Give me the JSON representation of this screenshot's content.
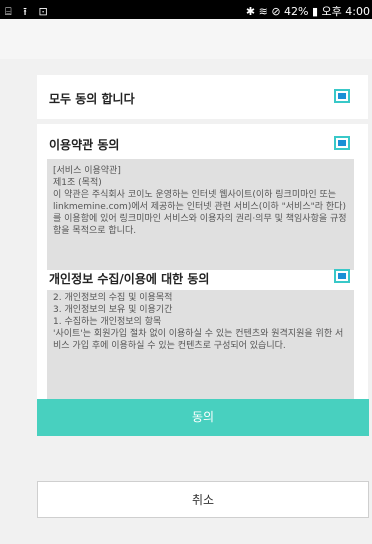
{
  "status_bar": {
    "left_icons": "⌸ ⭱ ⊡",
    "right_text": "✱ ≋ ⊘ 42% ▮ 오후 4:00"
  },
  "consent": {
    "all_agree_label": "모두 동의 합니다",
    "terms_label": "이용약관 동의",
    "terms_text": [
      "[서비스 이용약관]",
      "제1조 (목적)",
      "이 약관은 주식회사 코이노 운영하는 인터넷 웹사이트(이하 링크미마인 또는 linkmemine.com)에서 제공하는 인터넷 관련 서비스(이하 \"서비스\"라 한다)를 이용함에 있어 링크미마인 서비스와 이용자의 권리·의무 및 책임사항을 규정함을 목적으로 합니다."
    ],
    "privacy_label": "개인정보 수집/이용에 대한 동의",
    "privacy_text": [
      "2. 개인정보의 수집 및 이용목적",
      "3. 개인정보의 보유 및 이용기간",
      "",
      "1. 수집하는 개인정보의 항목",
      "'사이트'는 회원가입 절차 없이 이용하실 수 있는 컨텐츠와 원격지원을 위한 서비스 가입 후에 이용하실 수 있는 컨텐츠로 구성되어 있습니다."
    ]
  },
  "buttons": {
    "agree": "동의",
    "cancel": "취소"
  },
  "colors": {
    "accent": "#48d0bf",
    "check_fill": "#1b8fd6"
  }
}
